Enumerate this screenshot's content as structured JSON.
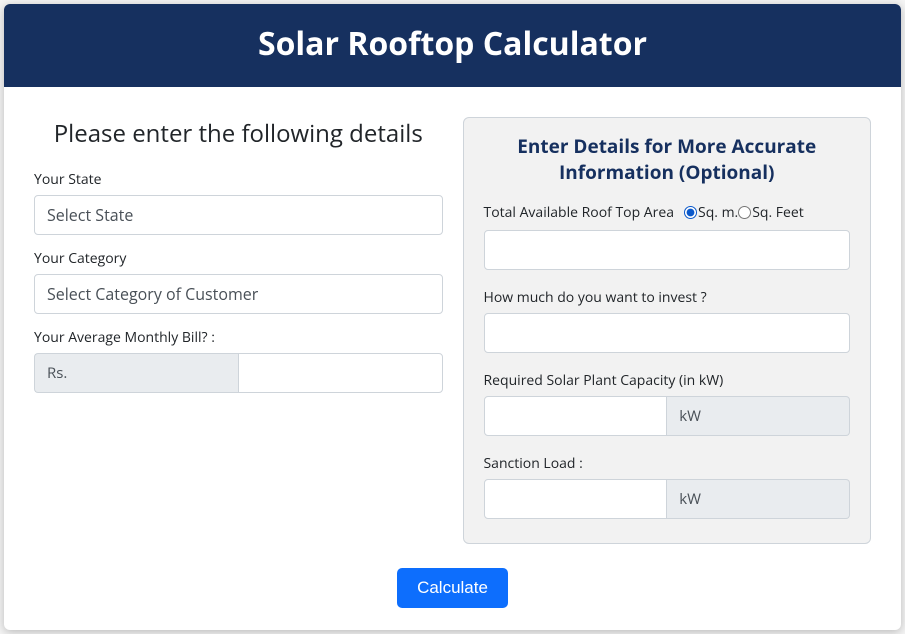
{
  "header": {
    "title": "Solar Rooftop Calculator"
  },
  "left": {
    "title": "Please enter the following details",
    "state": {
      "label": "Your State",
      "placeholder": "Select State"
    },
    "category": {
      "label": "Your Category",
      "placeholder": "Select Category of Customer"
    },
    "bill": {
      "label": "Your Average Monthly Bill?",
      "prefix": "Rs."
    }
  },
  "right": {
    "panelTitle": "Enter Details for More Accurate Information (Optional)",
    "roofArea": {
      "label": "Total Available Roof Top Area",
      "unit_sqm": "Sq. m.",
      "unit_sqft": "Sq. Feet"
    },
    "invest": {
      "label": "How much do you want to invest ?"
    },
    "capacity": {
      "label": "Required Solar Plant Capacity (in kW)",
      "suffix": "kW"
    },
    "sanction": {
      "label": "Sanction Load :",
      "suffix": "kW"
    }
  },
  "footer": {
    "calculate": "Calculate"
  }
}
